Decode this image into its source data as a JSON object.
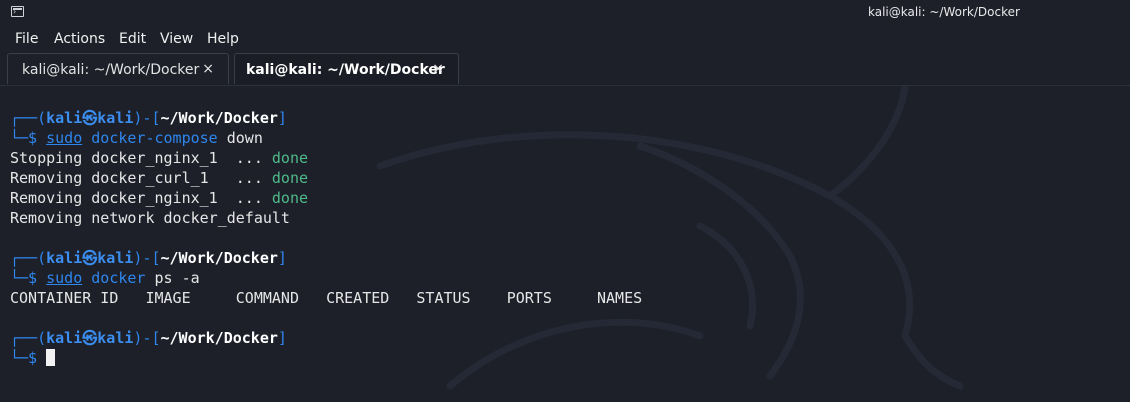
{
  "window": {
    "title": "kali@kali: ~/Work/Docker"
  },
  "menu": [
    "File",
    "Actions",
    "Edit",
    "View",
    "Help"
  ],
  "tabs": [
    {
      "label": "kali@kali: ~/Work/Docker",
      "close": "×",
      "active": false
    },
    {
      "label": "kali@kali: ~/Work/Docker",
      "close": "×",
      "active": true
    }
  ],
  "prompt": {
    "frame_open": "┌──(",
    "user": "kali",
    "at_symbol": "㉿",
    "host": "kali",
    "mid": ")-[",
    "path": "~/Work/Docker",
    "close": "]",
    "second_line": "└─$ "
  },
  "session": {
    "cmd1": {
      "sudo": "sudo",
      "name": "docker-compose",
      "args": " down"
    },
    "out1": [
      {
        "text": "Stopping docker_nginx_1  ... ",
        "status": "done"
      },
      {
        "text": "Removing docker_curl_1   ... ",
        "status": "done"
      },
      {
        "text": "Removing docker_nginx_1  ... ",
        "status": "done"
      },
      {
        "text": "Removing network docker_default",
        "status": ""
      }
    ],
    "cmd2": {
      "sudo": "sudo",
      "name": "docker",
      "args": " ps -a"
    },
    "out2": "CONTAINER ID   IMAGE     COMMAND   CREATED   STATUS    PORTS     NAMES"
  },
  "colors": {
    "background": "#1d2029",
    "prompt_blue": "#2e86ee",
    "done_green": "#4fb98a"
  },
  "icons": {
    "app": "terminal-icon",
    "tab_close": "close-icon",
    "background": "kali-dragon-watermark"
  }
}
